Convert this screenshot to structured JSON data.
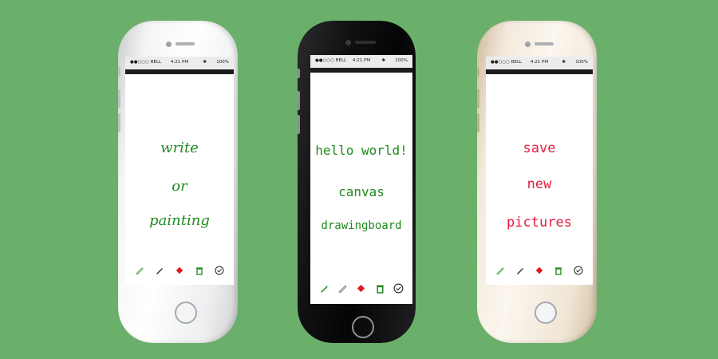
{
  "phones": [
    {
      "status": {
        "carrier": "●●○○○ BELL",
        "time": "4:21 PM",
        "battery": "100%",
        "bt": "✱"
      },
      "lines": [
        "write",
        "or",
        "painting"
      ]
    },
    {
      "status": {
        "carrier": "●●○○○ BELL",
        "time": "4:21 PM",
        "battery": "100%",
        "bt": "✱"
      },
      "lines": [
        "hello world!",
        "canvas",
        "drawingboard"
      ]
    },
    {
      "status": {
        "carrier": "●●○○○ BELL",
        "time": "4:21 PM",
        "battery": "100%",
        "bt": "✱"
      },
      "lines": [
        "save",
        "new",
        "pictures"
      ]
    }
  ],
  "colors": {
    "background": "#6bb06a",
    "green_ink": "#1e8a1e",
    "red_ink": "#e2193f"
  },
  "toolbar_icons": [
    "pencil-outline-icon",
    "pen-icon",
    "eraser-icon",
    "trash-icon",
    "check-circle-icon"
  ]
}
